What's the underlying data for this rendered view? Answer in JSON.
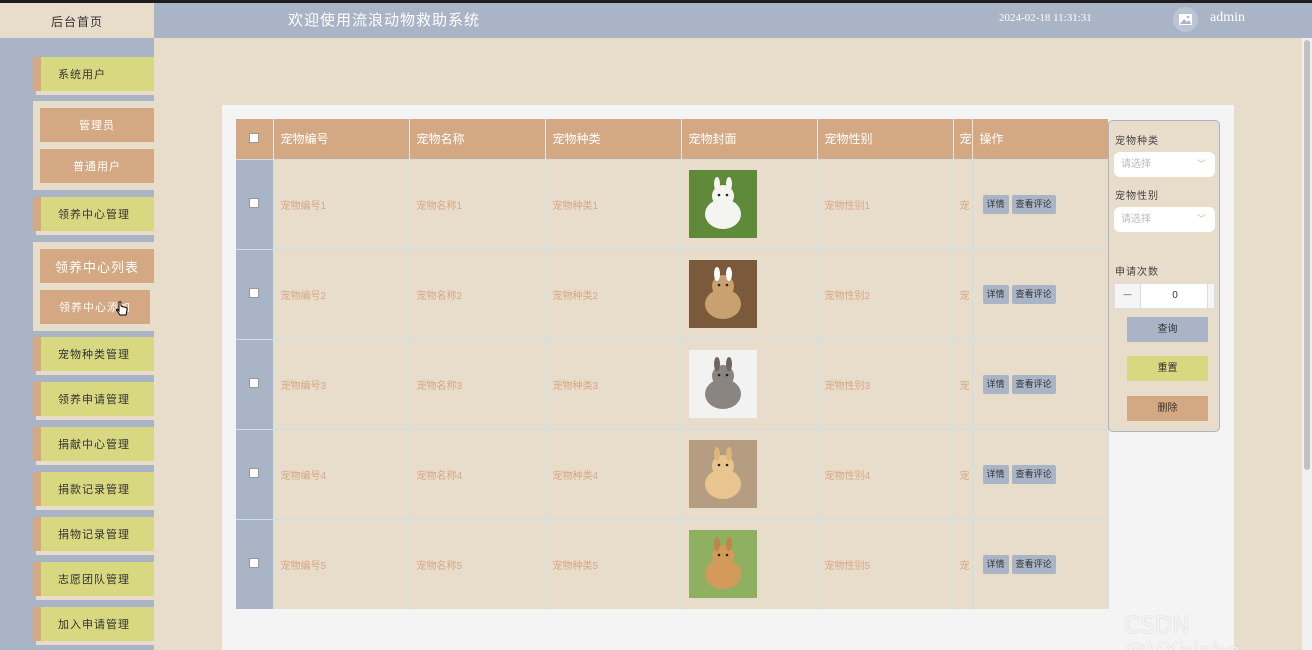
{
  "header": {
    "home_tab": "后台首页",
    "title": "欢迎使用流浪动物救助系统",
    "datetime": "2024-02-18 11:31:31",
    "user": "admin",
    "user_icon": "image-icon"
  },
  "sidebar": {
    "items": [
      {
        "label": "系统用户"
      },
      {
        "label": "管理员"
      },
      {
        "label": "普通用户"
      },
      {
        "label": "领养中心管理"
      },
      {
        "label": "领养中心列表"
      },
      {
        "label": "领养中心添加"
      },
      {
        "label": "宠物种类管理"
      },
      {
        "label": "领养申请管理"
      },
      {
        "label": "捐献中心管理"
      },
      {
        "label": "捐款记录管理"
      },
      {
        "label": "捐物记录管理"
      },
      {
        "label": "志愿团队管理"
      },
      {
        "label": "加入申请管理"
      }
    ]
  },
  "table": {
    "columns": [
      "宠物编号",
      "宠物名称",
      "宠物种类",
      "宠物封面",
      "宠物性别",
      "宠",
      "操作"
    ],
    "rows": [
      {
        "id": "宠物编号1",
        "name": "宠物名称1",
        "kind": "宠物种类1",
        "gender": "宠物性别1",
        "extra": "宠"
      },
      {
        "id": "宠物编号2",
        "name": "宠物名称2",
        "kind": "宠物种类2",
        "gender": "宠物性别2",
        "extra": "宠"
      },
      {
        "id": "宠物编号3",
        "name": "宠物名称3",
        "kind": "宠物种类3",
        "gender": "宠物性别3",
        "extra": "宠"
      },
      {
        "id": "宠物编号4",
        "name": "宠物名称4",
        "kind": "宠物种类4",
        "gender": "宠物性别4",
        "extra": "宠"
      },
      {
        "id": "宠物编号5",
        "name": "宠物名称5",
        "kind": "宠物种类5",
        "gender": "宠物性别5",
        "extra": "宠"
      }
    ],
    "action_detail": "详情",
    "action_comments": "查看评论"
  },
  "filter": {
    "kind_label": "宠物种类",
    "kind_placeholder": "请选择",
    "gender_label": "宠物性别",
    "gender_placeholder": "请选择",
    "count_label": "申请次数",
    "count_value": "0",
    "minus": "−",
    "query_button": "查询",
    "reset_button": "重置",
    "delete_button": "删除"
  },
  "colors": {
    "sidebar_bg": "#a9b5c7",
    "menu_item": "#d8d880",
    "accent": "#d4a882",
    "page_bg": "#e8dccb"
  },
  "watermark": "CSDN @VXbishe"
}
